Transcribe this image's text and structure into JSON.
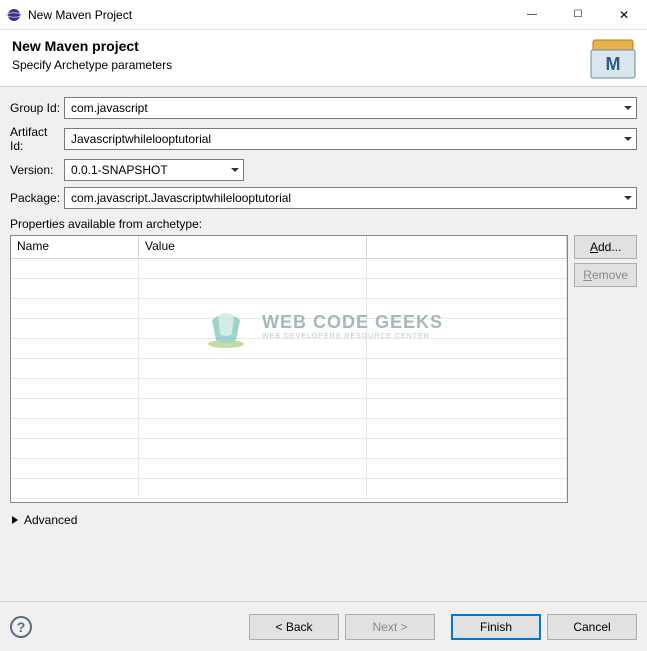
{
  "window": {
    "title": "New Maven Project"
  },
  "header": {
    "title": "New Maven project",
    "subtitle": "Specify Archetype parameters"
  },
  "form": {
    "group_id_label": "Group Id:",
    "group_id_value": "com.javascript",
    "artifact_id_label": "Artifact Id:",
    "artifact_id_value": "Javascriptwhilelooptutorial",
    "version_label": "Version:",
    "version_value": "0.0.1-SNAPSHOT",
    "package_label": "Package:",
    "package_value": "com.javascript.Javascriptwhilelooptutorial"
  },
  "properties": {
    "caption": "Properties available from archetype:",
    "columns": {
      "name": "Name",
      "value": "Value"
    },
    "add_label": "Add...",
    "remove_label": "Remove"
  },
  "advanced_label": "Advanced",
  "footer": {
    "back": "< Back",
    "next": "Next >",
    "finish": "Finish",
    "cancel": "Cancel"
  },
  "watermark": {
    "line1": "WEB CODE GEEKS",
    "line2": "WEB DEVELOPERS RESOURCE CENTER"
  }
}
